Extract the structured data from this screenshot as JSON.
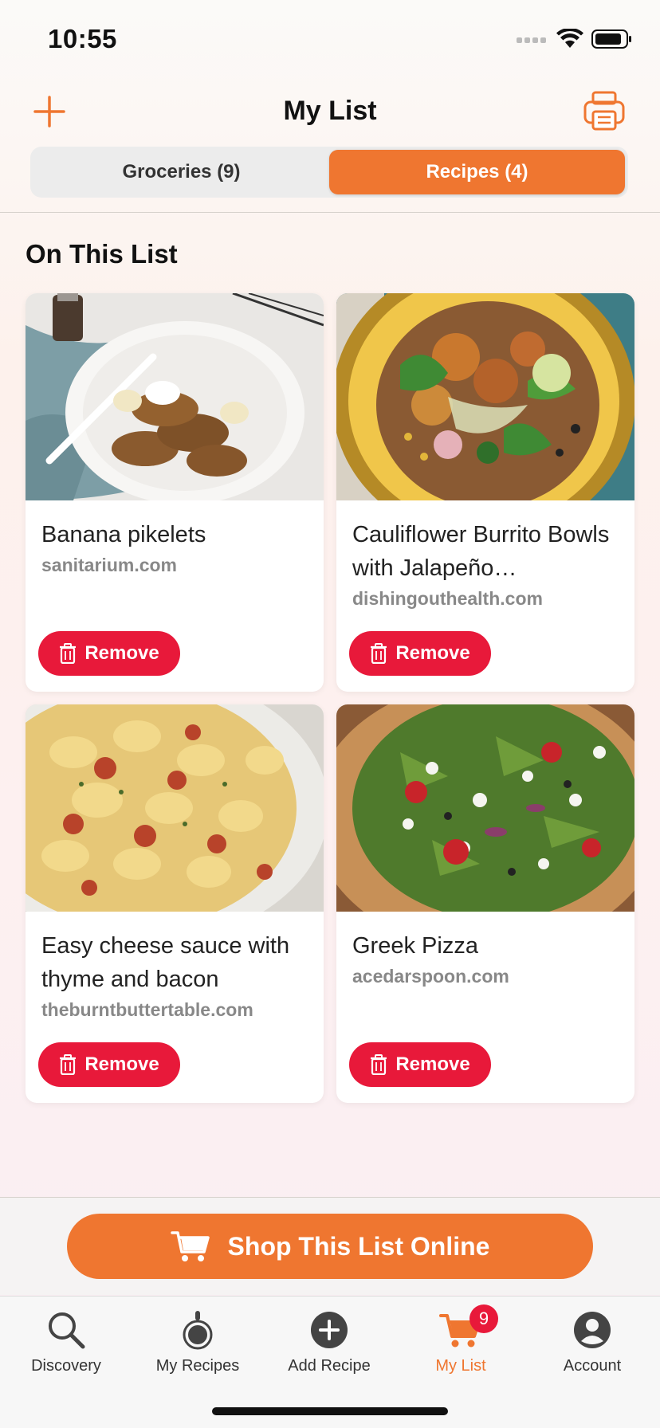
{
  "status_bar": {
    "time": "10:55"
  },
  "header": {
    "title": "My List"
  },
  "segments": [
    {
      "label": "Groceries (9)",
      "active": false
    },
    {
      "label": "Recipes (4)",
      "active": true
    }
  ],
  "section_title": "On This List",
  "recipes": [
    {
      "title": "Banana pikelets",
      "source": "sanitarium.com",
      "remove_label": "Remove",
      "image_icon": "pikelets-photo"
    },
    {
      "title": "Cauliflower Burrito Bowls with Jalapeño…",
      "source": "dishingouthealth.com",
      "remove_label": "Remove",
      "image_icon": "burrito-bowl-photo"
    },
    {
      "title": "Easy cheese sauce with thyme and bacon",
      "source": "theburntbuttertable.com",
      "remove_label": "Remove",
      "image_icon": "cheese-pasta-photo"
    },
    {
      "title": "Greek Pizza",
      "source": "acedarspoon.com",
      "remove_label": "Remove",
      "image_icon": "greek-pizza-photo"
    }
  ],
  "shop_button": {
    "label": "Shop This List Online"
  },
  "tabbar": {
    "tabs": [
      {
        "label": "Discovery",
        "icon": "search-icon"
      },
      {
        "label": "My Recipes",
        "icon": "pot-icon"
      },
      {
        "label": "Add Recipe",
        "icon": "plus-circle-icon"
      },
      {
        "label": "My List",
        "icon": "cart-icon",
        "badge": "9",
        "active": true
      },
      {
        "label": "Account",
        "icon": "person-icon"
      }
    ]
  },
  "colors": {
    "accent": "#ef7630",
    "danger": "#e8193a"
  }
}
